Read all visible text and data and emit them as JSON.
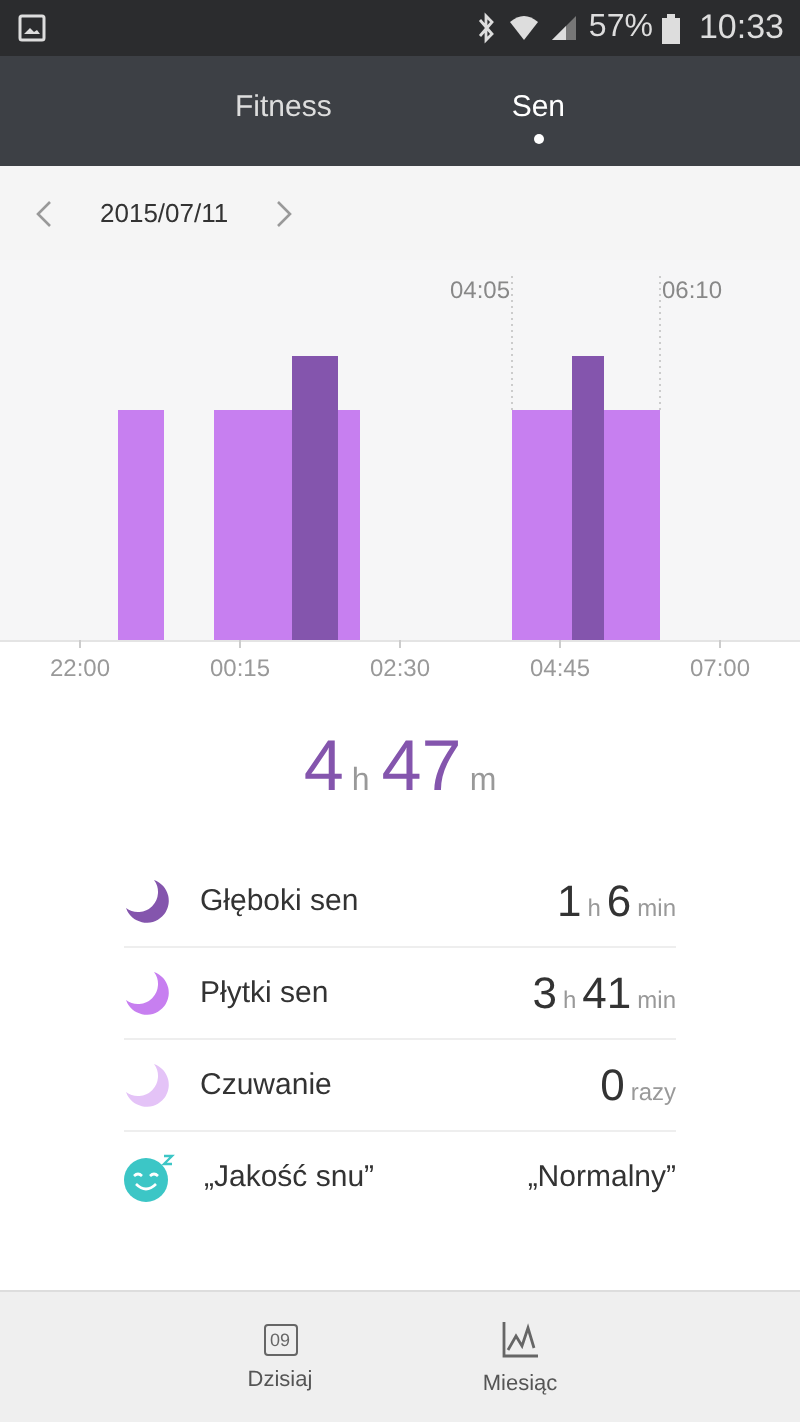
{
  "status_bar": {
    "battery": "57%",
    "time": "10:33"
  },
  "tabs": [
    {
      "label": "Fitness",
      "selected": false
    },
    {
      "label": "Sen",
      "selected": true
    }
  ],
  "date_nav": {
    "date": "2015/07/11"
  },
  "sleep_chart": {
    "markers": [
      "04:05",
      "06:10"
    ],
    "x_labels": [
      "22:00",
      "00:15",
      "02:30",
      "04:45",
      "07:00"
    ]
  },
  "total": [
    {
      "n": "4",
      "unit": "h"
    },
    {
      "n": "47",
      "unit": "m"
    }
  ],
  "stats": [
    {
      "kind": "moon",
      "color": "#8455ad",
      "label": "Głęboki sen",
      "values": [
        {
          "n": "1",
          "unit": "h"
        },
        {
          "n": "6",
          "unit": "min"
        }
      ]
    },
    {
      "kind": "moon",
      "color": "#c77ff0",
      "label": "Płytki sen",
      "values": [
        {
          "n": "3",
          "unit": "h"
        },
        {
          "n": "41",
          "unit": "min"
        }
      ]
    },
    {
      "kind": "moon",
      "color": "#e4c3f7",
      "label": "Czuwanie",
      "values": [
        {
          "n": "0",
          "unit": "razy"
        }
      ]
    },
    {
      "kind": "quality",
      "color": "#3cc6c6",
      "label": "„Jakość snu”",
      "text": "„Normalny”"
    }
  ],
  "bottom_nav": [
    {
      "kind": "calendar",
      "label": "Dzisiaj",
      "icon_text": "09"
    },
    {
      "kind": "trend",
      "label": "Miesiąc"
    }
  ]
}
